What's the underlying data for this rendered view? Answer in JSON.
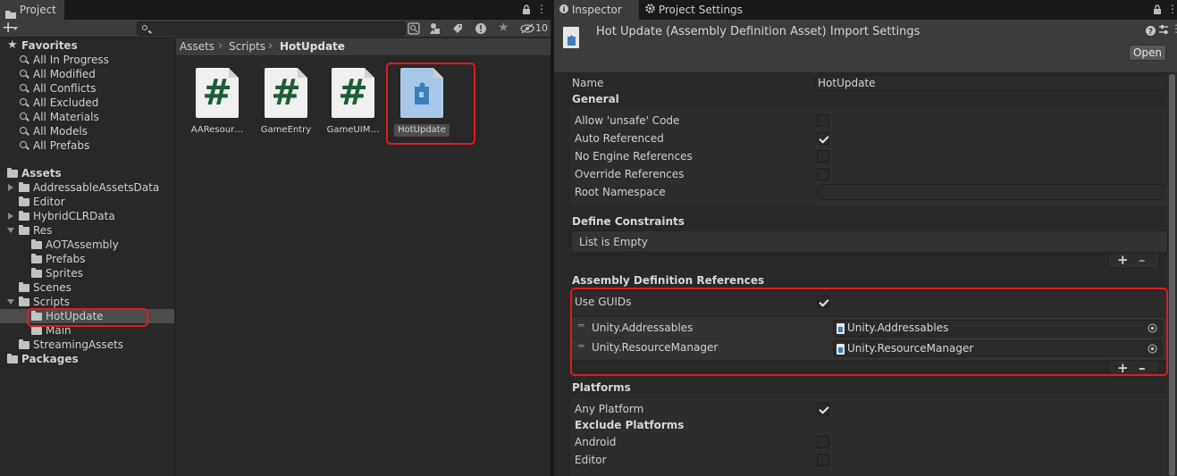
{
  "project_panel": {
    "tab_label": "Project",
    "hidden_count": "10",
    "search_placeholder": "",
    "breadcrumb": [
      "Assets",
      "Scripts",
      "HotUpdate"
    ],
    "favorites": {
      "label": "Favorites",
      "items": [
        "All In Progress",
        "All Modified",
        "All Conflicts",
        "All Excluded",
        "All Materials",
        "All Models",
        "All Prefabs"
      ]
    },
    "tree": {
      "assets_label": "Assets",
      "packages_label": "Packages",
      "items": [
        {
          "label": "AddressableAssetsData"
        },
        {
          "label": "Editor"
        },
        {
          "label": "HybridCLRData"
        },
        {
          "label": "Res"
        },
        {
          "label": "AOTAssembly"
        },
        {
          "label": "Prefabs"
        },
        {
          "label": "Sprites"
        },
        {
          "label": "Scenes"
        },
        {
          "label": "Scripts"
        },
        {
          "label": "HotUpdate"
        },
        {
          "label": "Main"
        },
        {
          "label": "StreamingAssets"
        }
      ]
    },
    "assets": [
      {
        "label": "AAResour…",
        "type": "script"
      },
      {
        "label": "GameEntry",
        "type": "script"
      },
      {
        "label": "GameUIM…",
        "type": "script"
      },
      {
        "label": "HotUpdate",
        "type": "asmdef"
      }
    ]
  },
  "inspector_panel": {
    "tabs": [
      "Inspector",
      "Project Settings"
    ],
    "header_title": "Hot Update (Assembly Definition Asset) Import Settings",
    "open_button": "Open",
    "name_label": "Name",
    "name_value": "HotUpdate",
    "general": {
      "label": "General",
      "allow_unsafe": {
        "label": "Allow 'unsafe' Code",
        "checked": false
      },
      "auto_referenced": {
        "label": "Auto Referenced",
        "checked": true
      },
      "no_engine_refs": {
        "label": "No Engine References",
        "checked": false
      },
      "override_refs": {
        "label": "Override References",
        "checked": false
      },
      "root_namespace": {
        "label": "Root Namespace",
        "value": ""
      }
    },
    "define_constraints": {
      "label": "Define Constraints",
      "empty_text": "List is Empty"
    },
    "assembly_refs": {
      "label": "Assembly Definition References",
      "use_guids": {
        "label": "Use GUIDs",
        "checked": true
      },
      "items": [
        {
          "label": "Unity.Addressables",
          "value": "Unity.Addressables"
        },
        {
          "label": "Unity.ResourceManager",
          "value": "Unity.ResourceManager"
        }
      ]
    },
    "platforms": {
      "label": "Platforms",
      "any_platform": {
        "label": "Any Platform",
        "checked": true
      },
      "exclude_label": "Exclude Platforms",
      "items": [
        {
          "label": "Android",
          "checked": false
        },
        {
          "label": "Editor",
          "checked": false
        }
      ]
    }
  },
  "colors": {
    "highlight": "#e11b1b",
    "selection": "#2c5d87",
    "script_hash": "#1c5e34",
    "asmdef_icon": "#3d7fb8"
  }
}
